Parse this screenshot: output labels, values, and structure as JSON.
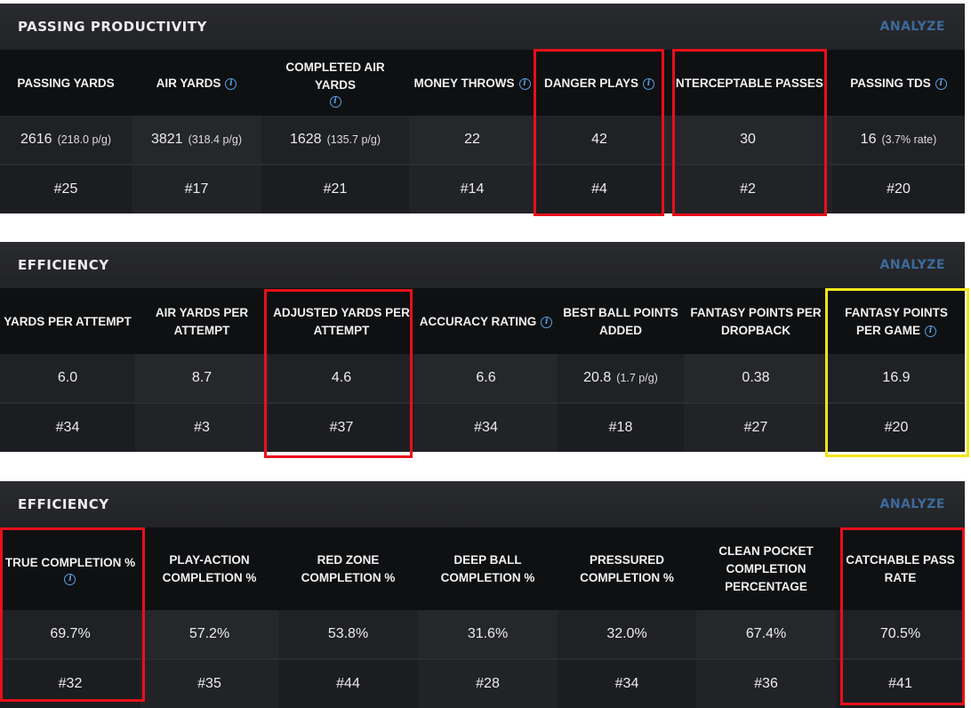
{
  "sections": [
    {
      "title": "PASSING PRODUCTIVITY",
      "analyze": "ANALYZE",
      "columns": [
        {
          "label": "PASSING YARDS",
          "value": "2616",
          "sub": "(218.0 p/g)",
          "rank": "#25"
        },
        {
          "label": "AIR YARDS",
          "value": "3821",
          "sub": "(318.4 p/g)",
          "rank": "#17"
        },
        {
          "label": "COMPLETED AIR YARDS",
          "value": "1628",
          "sub": "(135.7 p/g)",
          "rank": "#21"
        },
        {
          "label": "MONEY THROWS",
          "value": "22",
          "sub": "",
          "rank": "#14"
        },
        {
          "label": "DANGER PLAYS",
          "value": "42",
          "sub": "",
          "rank": "#4"
        },
        {
          "label": "INTERCEPTABLE PASSES",
          "value": "30",
          "sub": "",
          "rank": "#2"
        },
        {
          "label": "PASSING TDS",
          "value": "16",
          "sub": "(3.7% rate)",
          "rank": "#20"
        }
      ]
    },
    {
      "title": "EFFICIENCY",
      "analyze": "ANALYZE",
      "columns": [
        {
          "label": "YARDS PER ATTEMPT",
          "value": "6.0",
          "sub": "",
          "rank": "#34"
        },
        {
          "label": "AIR YARDS PER ATTEMPT",
          "value": "8.7",
          "sub": "",
          "rank": "#3"
        },
        {
          "label": "ADJUSTED YARDS PER ATTEMPT",
          "value": "4.6",
          "sub": "",
          "rank": "#37"
        },
        {
          "label": "ACCURACY RATING",
          "value": "6.6",
          "sub": "",
          "rank": "#34"
        },
        {
          "label": "BEST BALL POINTS ADDED",
          "value": "20.8",
          "sub": "(1.7 p/g)",
          "rank": "#18"
        },
        {
          "label": "FANTASY POINTS PER DROPBACK",
          "value": "0.38",
          "sub": "",
          "rank": "#27"
        },
        {
          "label": "FANTASY POINTS PER GAME",
          "value": "16.9",
          "sub": "",
          "rank": "#20"
        }
      ]
    },
    {
      "title": "EFFICIENCY",
      "analyze": "ANALYZE",
      "columns": [
        {
          "label": "TRUE COMPLETION %",
          "value": "69.7%",
          "sub": "",
          "rank": "#32"
        },
        {
          "label": "PLAY-ACTION COMPLETION %",
          "value": "57.2%",
          "sub": "",
          "rank": "#35"
        },
        {
          "label": "RED ZONE COMPLETION %",
          "value": "53.8%",
          "sub": "",
          "rank": "#44"
        },
        {
          "label": "DEEP BALL COMPLETION %",
          "value": "31.6%",
          "sub": "",
          "rank": "#28"
        },
        {
          "label": "PRESSURED COMPLETION %",
          "value": "32.0%",
          "sub": "",
          "rank": "#34"
        },
        {
          "label": "CLEAN POCKET COMPLETION PERCENTAGE",
          "value": "67.4%",
          "sub": "",
          "rank": "#36"
        },
        {
          "label": "CATCHABLE PASS RATE",
          "value": "70.5%",
          "sub": "",
          "rank": "#41"
        }
      ]
    }
  ],
  "info_icon": "i",
  "highlight_colors": {
    "red": "#e8101a",
    "yellow": "#f2e41a"
  },
  "accent_analyze": "#3d6a9c",
  "accent_info": "#5aa0e6"
}
